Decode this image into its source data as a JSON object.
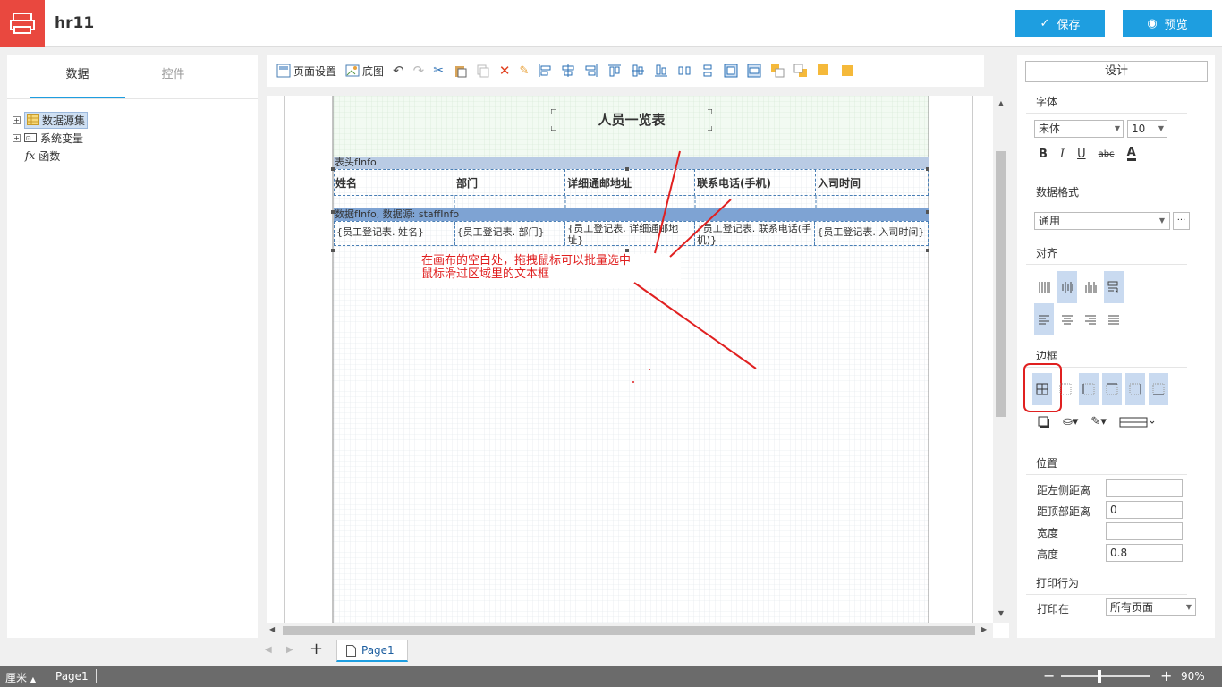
{
  "app": {
    "title": "hr11"
  },
  "header": {
    "save_label": "保存",
    "preview_label": "预览"
  },
  "left": {
    "tabs": [
      {
        "label": "数据"
      },
      {
        "label": "控件"
      }
    ],
    "tree": [
      {
        "label": "数据源集",
        "icon": "table-icon"
      },
      {
        "label": "系统变量",
        "icon": "variable-icon"
      },
      {
        "label": "函数",
        "icon": "function-icon",
        "prefix": "fx"
      }
    ]
  },
  "toolbar": {
    "page_setup": "页面设置",
    "background": "底图"
  },
  "canvas": {
    "title": "人员一览表",
    "header_band": "表头fInfo",
    "data_band": "数据fInfo, 数据源: staffInfo",
    "columns": [
      "姓名",
      "部门",
      "详细通邮地址",
      "联系电话(手机)",
      "入司时间"
    ],
    "cells": [
      "{员工登记表. 姓名}",
      "{员工登记表. 部门}",
      "{员工登记表. 详细通邮地址}",
      "{员工登记表. 联系电话(手机)}",
      "{员工登记表. 入司时间}"
    ],
    "annotation_line1": "在画布的空白处，拖拽鼠标可以批量选中",
    "annotation_line2": "鼠标滑过区域里的文本框",
    "annotation_color": "#e02020"
  },
  "right": {
    "design_label": "设计",
    "font_section": "字体",
    "font_name": "宋体",
    "font_size": "10",
    "format_section": "数据格式",
    "format_value": "通用",
    "align_section": "对齐",
    "border_section": "边框",
    "position_section": "位置",
    "left_dist_label": "距左侧距离",
    "left_dist_value": "",
    "top_dist_label": "距顶部距离",
    "top_dist_value": "0",
    "width_label": "宽度",
    "width_value": "",
    "height_label": "高度",
    "height_value": "0.8",
    "print_section": "打印行为",
    "print_on_label": "打印在",
    "print_on_value": "所有页面"
  },
  "pages": {
    "tab": "Page1"
  },
  "status": {
    "unit": "厘米",
    "page": "Page1",
    "zoom": "90%"
  }
}
